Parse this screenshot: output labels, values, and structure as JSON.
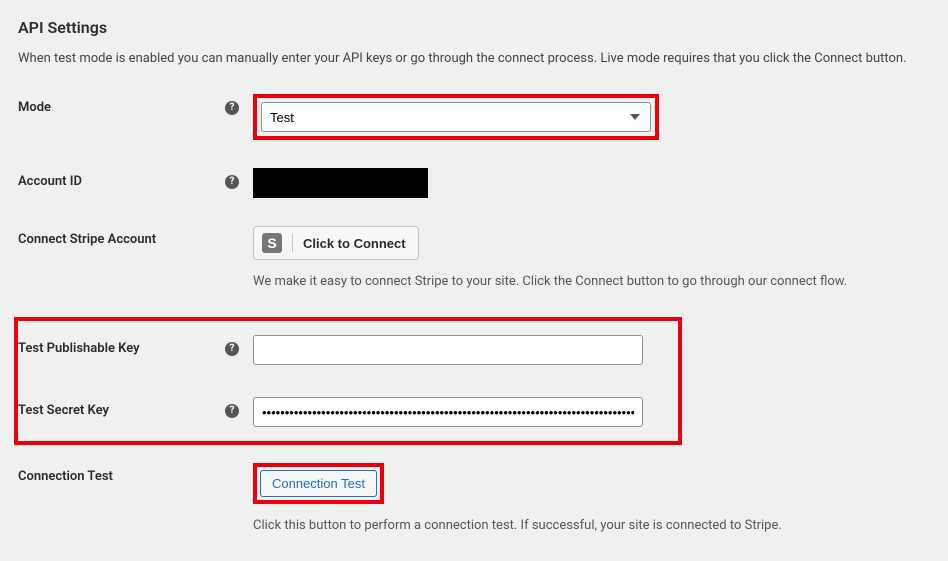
{
  "header": {
    "title": "API Settings",
    "description": "When test mode is enabled you can manually enter your API keys or go through the connect process. Live mode requires that you click the Connect button."
  },
  "fields": {
    "mode": {
      "label": "Mode",
      "value": "Test"
    },
    "account_id": {
      "label": "Account ID"
    },
    "connect": {
      "label": "Connect Stripe Account",
      "button": "Click to Connect",
      "stripe_glyph": "S",
      "helper": "We make it easy to connect Stripe to your site. Click the Connect button to go through our connect flow."
    },
    "pub_key": {
      "label": "Test Publishable Key",
      "value": ""
    },
    "secret_key": {
      "label": "Test Secret Key",
      "value": "••••••••••••••••••••••••••••••••••••••••••••••••••••••••••••••••••••••••••••••••••••••••••••••••••••••••••"
    },
    "conn_test": {
      "label": "Connection Test",
      "button": "Connection Test",
      "helper": "Click this button to perform a connection test. If successful, your site is connected to Stripe."
    }
  },
  "help_glyph": "?"
}
